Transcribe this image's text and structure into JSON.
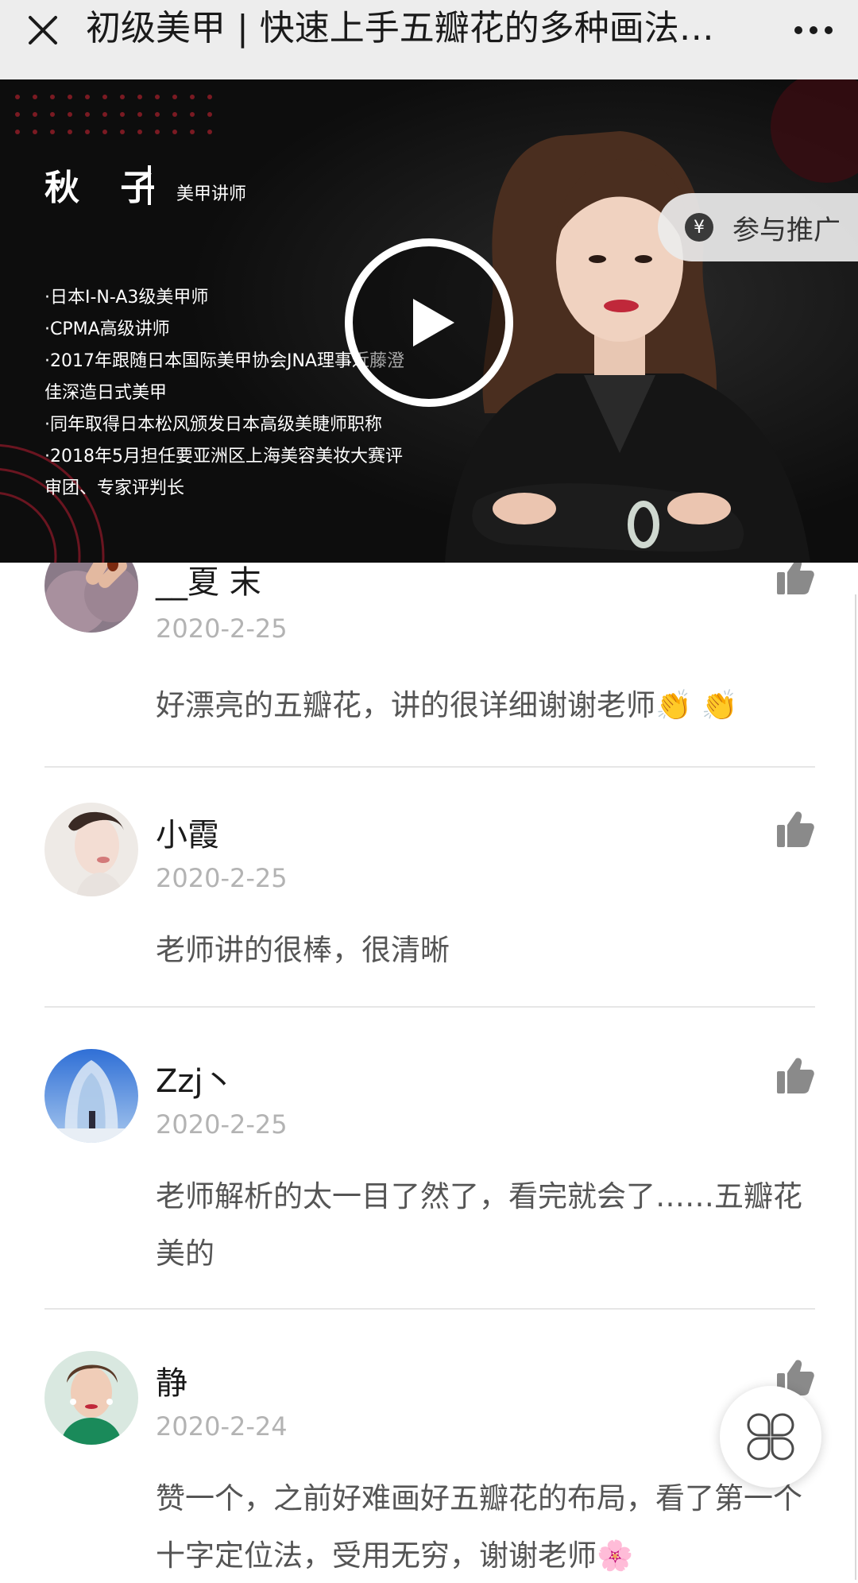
{
  "header": {
    "title": "初级美甲 | 快速上手五瓣花的多种画法…"
  },
  "video": {
    "instructor_name": "秋 子",
    "instructor_role": "美甲讲师",
    "credentials": [
      "·日本I-N-A3级美甲师",
      "·CPMA高级讲师",
      "·2017年跟随日本国际美甲协会JNA理事近藤澄",
      "佳深造日式美甲",
      "·同年取得日本松风颁发日本高级美睫师职称",
      "·2018年5月担任要亚洲区上海美容美妆大赛评",
      "审团、专家评判长"
    ],
    "promo_label": "参与推广",
    "promo_icon": "yen-icon",
    "play_icon": "play-icon"
  },
  "comments": [
    {
      "name": "__夏 末 ",
      "date": "2020-2-25",
      "text": "好漂亮的五瓣花，讲的很详细谢谢老师👏 👏"
    },
    {
      "name": "小霞",
      "date": "2020-2-25",
      "text": "老师讲的很棒，很清晰"
    },
    {
      "name": "Zzj丶",
      "date": "2020-2-25",
      "text": "老师解析的太一目了然了，看完就会了……五瓣花美的"
    },
    {
      "name": "静",
      "date": "2020-2-24",
      "text": "赞一个，之前好难画好五瓣花的布局，看了第一个十字定位法，受用无穷，谢谢老师🌸"
    }
  ],
  "colors": {
    "topbar_bg": "#ededed",
    "video_bg": "#0d0d0d",
    "date_gray": "#b3b3b3",
    "text_gray": "#555555",
    "like_gray": "#8a8a8a"
  },
  "icons": {
    "close": "close-icon",
    "more": "more-icon",
    "like": "thumbs-up-icon",
    "menu": "clover-menu-icon"
  }
}
